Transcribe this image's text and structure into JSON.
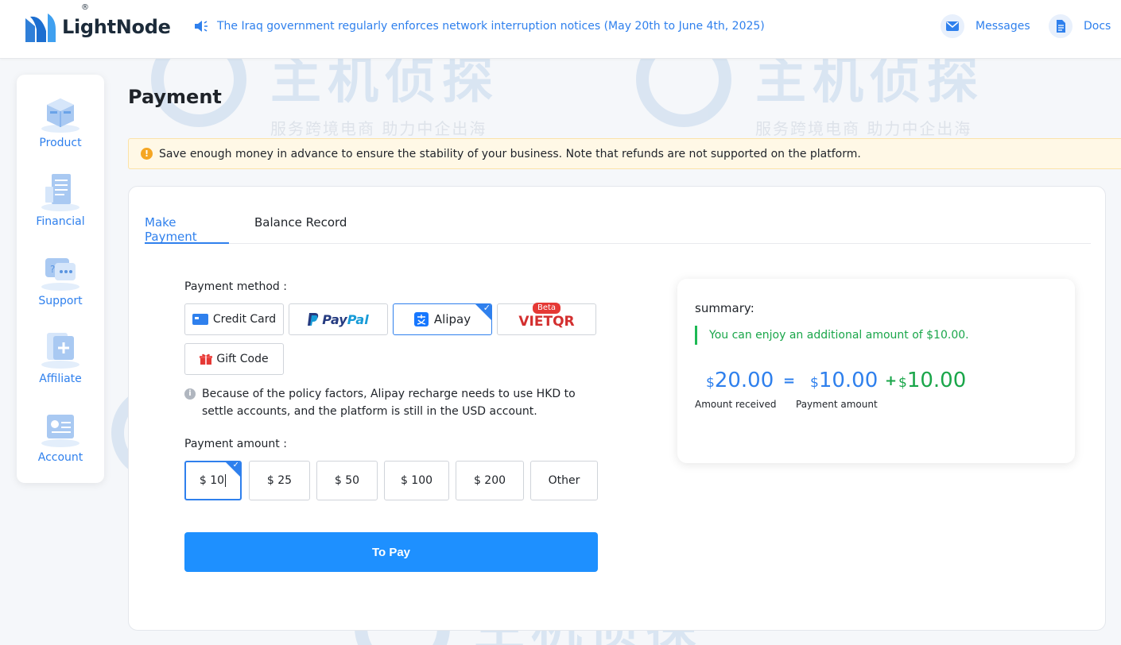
{
  "header": {
    "logo_text": "LightNode",
    "logo_reg": "®",
    "notice": "The Iraq government regularly enforces network interruption notices (May 20th to June 4th, 2025)",
    "messages_label": "Messages",
    "docs_label": "Docs"
  },
  "watermark": {
    "big": "主机侦探",
    "small": "服务跨境电商 助力中企出海"
  },
  "sidebar": {
    "items": [
      {
        "label": "Product"
      },
      {
        "label": "Financial"
      },
      {
        "label": "Support"
      },
      {
        "label": "Affiliate"
      },
      {
        "label": "Account"
      }
    ]
  },
  "page": {
    "title": "Payment",
    "warning": "Save enough money in advance to ensure the stability of your business. Note that refunds are not supported on the platform."
  },
  "tabs": [
    {
      "label": "Make Payment",
      "active": true
    },
    {
      "label": "Balance Record",
      "active": false
    }
  ],
  "payment": {
    "method_label": "Payment method :",
    "methods": {
      "credit_card": "Credit Card",
      "paypal_pay": "Pay",
      "paypal_pal": "Pal",
      "alipay": "Alipay",
      "vietqr": "VIETQR",
      "vietqr_badge": "Beta",
      "gift_code": "Gift Code"
    },
    "selected_method": "Alipay",
    "policy_note": "Because of the policy factors, Alipay recharge needs to use HKD to settle accounts, and the platform is still in the USD account.",
    "amount_label": "Payment amount :",
    "amounts": [
      "$ 10",
      "$ 25",
      "$ 50",
      "$ 100",
      "$ 200",
      "Other"
    ],
    "selected_amount": "$ 10",
    "pay_button": "To Pay"
  },
  "summary": {
    "title": "summary:",
    "note": "You can enjoy an additional amount of $10.00.",
    "currency": "$",
    "received_value": "20.00",
    "payment_value": "10.00",
    "bonus_value": "10.00",
    "equals": "=",
    "plus": "+",
    "received_caption": "Amount received",
    "payment_caption": "Payment amount"
  },
  "colors": {
    "accent": "#2f80ed",
    "pay_button": "#1e90ff",
    "success": "#1aa64a",
    "warning_bg": "#fff8e6",
    "warning_icon": "#f5a623"
  }
}
